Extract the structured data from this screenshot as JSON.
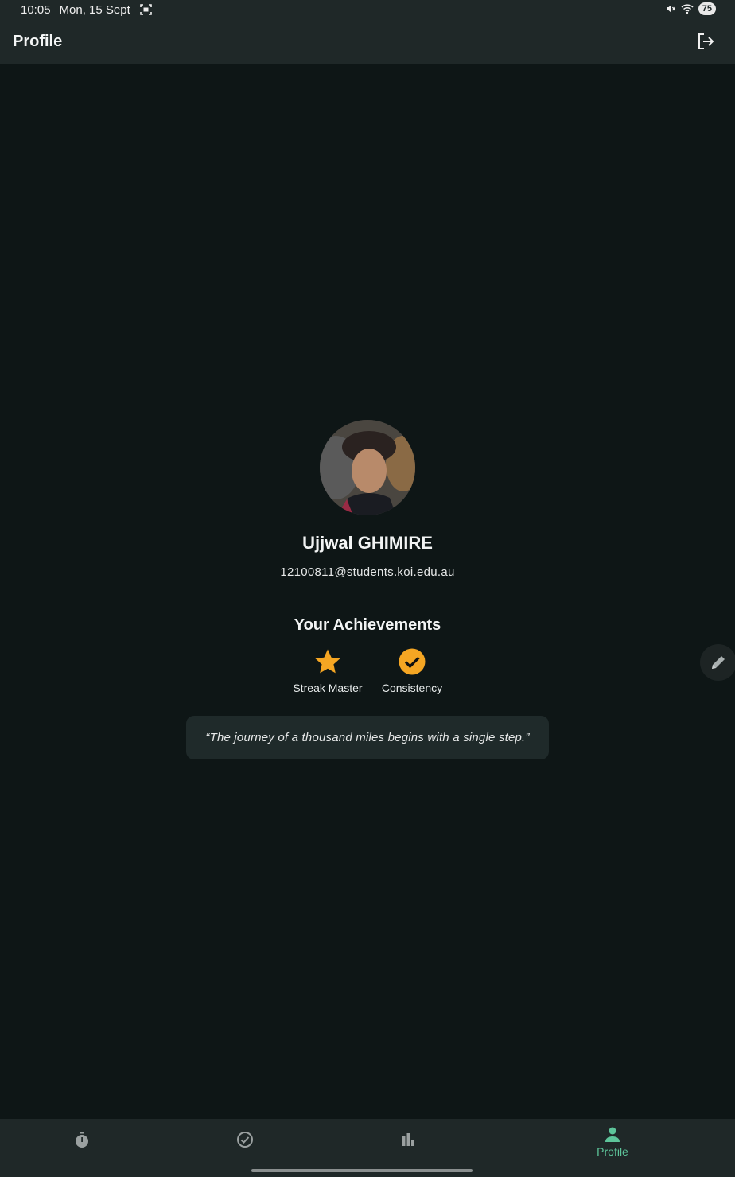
{
  "status_bar": {
    "time": "10:05",
    "date": "Mon, 15 Sept",
    "battery": "75",
    "icons": [
      "screenshot-icon",
      "mute-icon",
      "wifi-icon",
      "battery-icon"
    ]
  },
  "app_bar": {
    "title": "Profile",
    "action_icon": "logout-icon"
  },
  "profile": {
    "avatar_icon": "profile-photo",
    "name": "Ujjwal GHIMIRE",
    "email": "12100811@students.koi.edu.au"
  },
  "achievements": {
    "title": "Your Achievements",
    "items": [
      {
        "label": "Streak Master",
        "icon": "star-icon"
      },
      {
        "label": "Consistency",
        "icon": "check-circle-icon"
      }
    ]
  },
  "quote": "“The journey of a thousand miles begins with a single step.”",
  "edit_fab_icon": "pencil-icon",
  "bottom_nav": {
    "items": [
      {
        "icon": "timer-icon",
        "label": ""
      },
      {
        "icon": "check-circle-outline-icon",
        "label": ""
      },
      {
        "icon": "bar-chart-icon",
        "label": ""
      },
      {
        "icon": "person-icon",
        "label": "Profile",
        "selected": true
      }
    ]
  },
  "colors": {
    "background": "#0e1616",
    "bar": "#1f2828",
    "accent": "#f5a623",
    "selected_nav": "#5dc49a",
    "card": "#1f2a2a"
  }
}
